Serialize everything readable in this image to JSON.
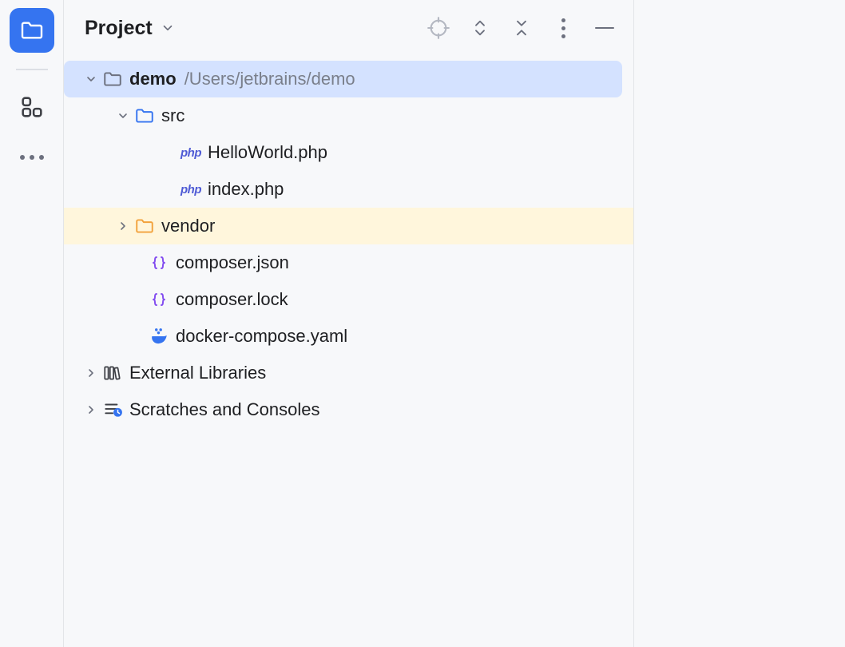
{
  "header": {
    "title": "Project"
  },
  "tree": {
    "root": {
      "name": "demo",
      "path": "/Users/jetbrains/demo"
    },
    "src": {
      "name": "src"
    },
    "files": {
      "hello": "HelloWorld.php",
      "index": "index.php",
      "composer_json": "composer.json",
      "composer_lock": "composer.lock",
      "docker": "docker-compose.yaml"
    },
    "vendor": {
      "name": "vendor"
    },
    "external": "External Libraries",
    "scratches": "Scratches and Consoles"
  },
  "icons": {
    "php": "php"
  }
}
